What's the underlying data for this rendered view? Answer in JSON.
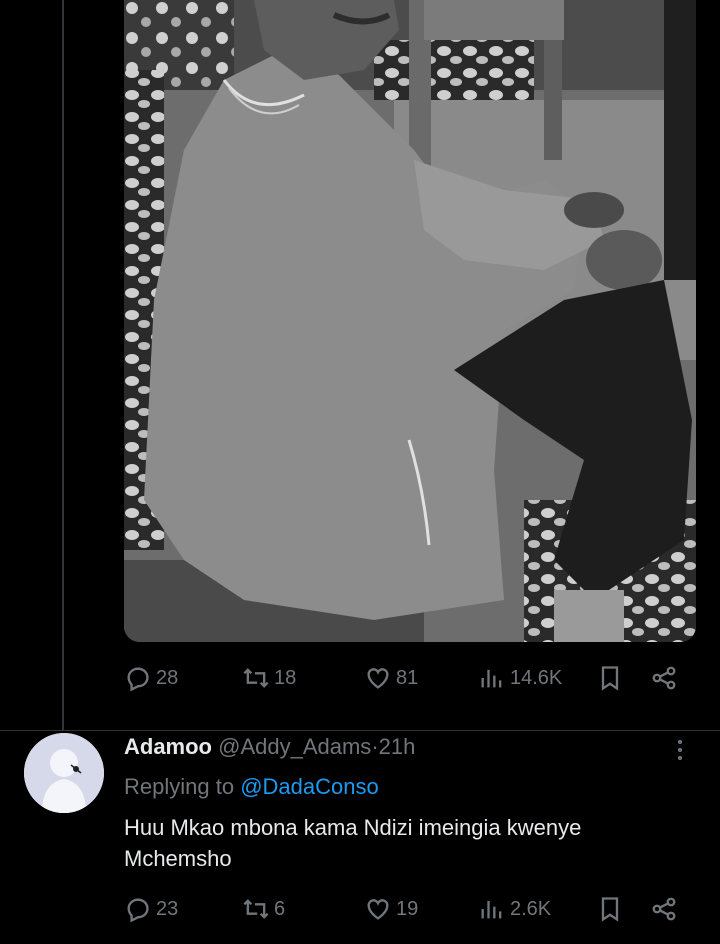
{
  "tweet": {
    "metrics": {
      "replies": "28",
      "retweets": "18",
      "likes": "81",
      "views": "14.6K"
    }
  },
  "reply": {
    "display_name": "Adamoo",
    "handle": "@Addy_Adams",
    "separator": "·",
    "time": "21h",
    "replying_prefix": "Replying to",
    "replying_to": "@DadaConso",
    "text": "Huu Mkao mbona kama Ndizi imeingia kwenye Mchemsho",
    "metrics": {
      "replies": "23",
      "retweets": "6",
      "likes": "19",
      "views": "2.6K"
    }
  },
  "icons": {
    "reply": "reply-icon",
    "retweet": "retweet-icon",
    "like": "heart-icon",
    "views": "views-icon",
    "bookmark": "bookmark-icon",
    "share": "share-icon",
    "more": "more-icon"
  },
  "colors": {
    "background": "#000000",
    "text": "#e7e9ea",
    "muted": "#71767b",
    "link": "#1d9bf0"
  }
}
